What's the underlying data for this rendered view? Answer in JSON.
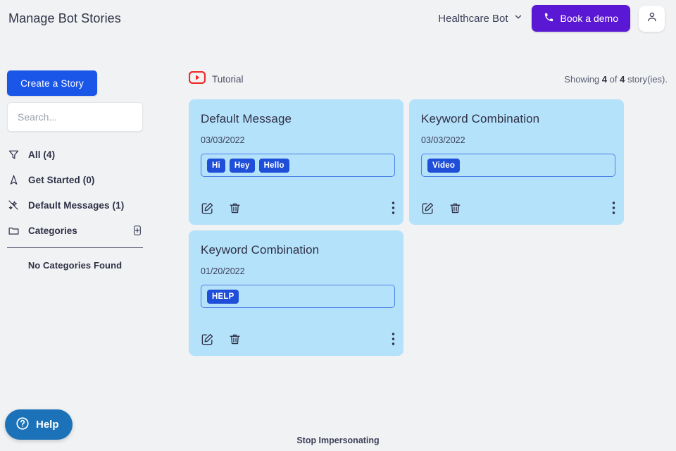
{
  "header": {
    "title": "Manage Bot Stories",
    "bot_name": "Healthcare Bot",
    "chevron_icon": "chevron-down-icon",
    "demo_label": "Book a demo",
    "demo_icon": "phone-icon",
    "avatar_icon": "person-icon",
    "accent_purple": "#5b18d4"
  },
  "sidebar": {
    "create_label": "Create a Story",
    "search_placeholder": "Search...",
    "search_value": "",
    "search_icon": "search-icon",
    "accent_blue": "#1a56e8",
    "items": [
      {
        "label": "All (4)",
        "icon": "filter-funnel-icon"
      },
      {
        "label": "Get Started (0)",
        "icon": "navigation-arrow-icon"
      },
      {
        "label": "Default Messages (1)",
        "icon": "magic-wand-off-icon"
      }
    ],
    "categories_label": "Categories",
    "categories_icon": "folder-icon",
    "add_category_icon": "add-box-icon",
    "empty_text": "No Categories Found"
  },
  "main": {
    "tutorial_label": "Tutorial",
    "tutorial_icon": "youtube-play-icon",
    "showing_prefix": "Showing ",
    "showing_count": "4",
    "showing_middle": " of ",
    "showing_total": "4",
    "showing_suffix": " story(ies).",
    "card_bg": "#b5e2fb",
    "tag_color": "#1f4fd8",
    "cards": [
      {
        "title": "Default Message",
        "date": "03/03/2022",
        "tags": [
          "Hi",
          "Hey",
          "Hello"
        ],
        "edit_icon": "edit-pencil-icon",
        "delete_icon": "trash-icon",
        "menu_icon": "kebab-menu-icon"
      },
      {
        "title": "Keyword Combination",
        "date": "03/03/2022",
        "tags": [
          "Video"
        ],
        "edit_icon": "edit-pencil-icon",
        "delete_icon": "trash-icon",
        "menu_icon": "kebab-menu-icon"
      },
      {
        "title": "Keyword Combination",
        "date": "01/20/2022",
        "tags": [
          "HELP"
        ],
        "edit_icon": "edit-pencil-icon",
        "delete_icon": "trash-icon",
        "menu_icon": "kebab-menu-icon"
      }
    ]
  },
  "footer": {
    "help_label": "Help",
    "help_icon": "question-circle-icon",
    "help_color": "#1b72b8",
    "impersonating_label": "Stop Impersonating"
  }
}
